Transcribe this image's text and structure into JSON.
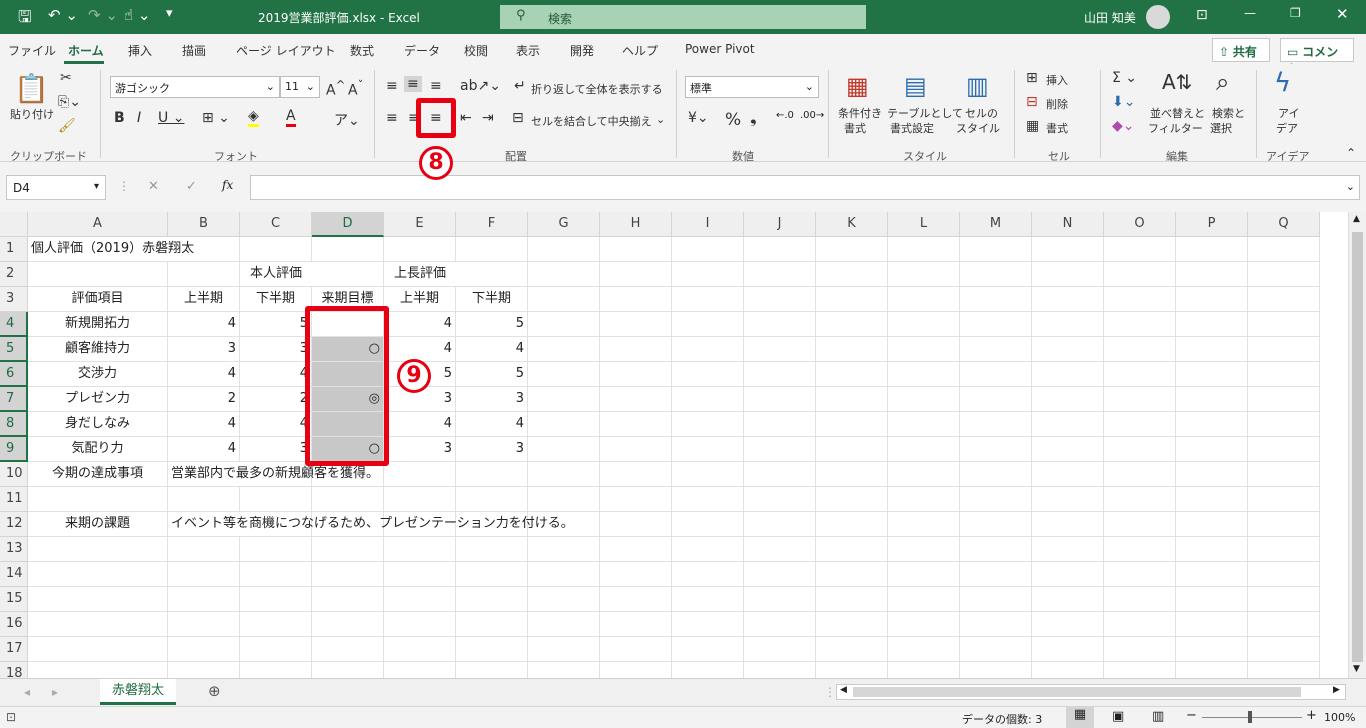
{
  "titlebar": {
    "filename": "2019営業部評価.xlsx - Excel",
    "search_placeholder": "検索",
    "user": "山田 知美"
  },
  "tabs": [
    "ファイル",
    "ホーム",
    "挿入",
    "描画",
    "ページ レイアウト",
    "数式",
    "データ",
    "校閲",
    "表示",
    "開発",
    "ヘルプ",
    "Power Pivot"
  ],
  "share_label": "共有",
  "comment_label": "コメント",
  "ribbon": {
    "paste_label": "貼り付け",
    "clipboard_group": "クリップボード",
    "font_name": "游ゴシック",
    "font_size": "11",
    "font_group": "フォント",
    "wrap_text": "折り返して全体を表示する",
    "merge_center": "セルを結合して中央揃え",
    "alignment_group": "配置",
    "number_format": "標準",
    "number_group": "数値",
    "cond_format": "条件付き\n書式",
    "cond_format_l1": "条件付き",
    "cond_format_l2": "書式",
    "table_format_l1": "テーブルとして",
    "table_format_l2": "書式設定",
    "cell_style_l1": "セルの",
    "cell_style_l2": "スタイル",
    "style_group": "スタイル",
    "insert": "挿入",
    "delete": "削除",
    "format": "書式",
    "cells_group": "セル",
    "sort_l1": "並べ替えと",
    "sort_l2": "フィルター",
    "find_l1": "検索と",
    "find_l2": "選択",
    "edit_group": "編集",
    "ideas_l1": "アイ",
    "ideas_l2": "デア",
    "ideas_group": "アイデア"
  },
  "namebox": "D4",
  "fx": "fx",
  "columns": [
    "A",
    "B",
    "C",
    "D",
    "E",
    "F",
    "G",
    "H",
    "I",
    "J",
    "K",
    "L",
    "M",
    "N",
    "O",
    "P",
    "Q"
  ],
  "rows": [
    "1",
    "2",
    "3",
    "4",
    "5",
    "6",
    "7",
    "8",
    "9",
    "10",
    "11",
    "12",
    "13",
    "14",
    "15",
    "16",
    "17",
    "18"
  ],
  "cells": {
    "A1": "個人評価（2019）赤磐翔太",
    "C2": "本人評価",
    "E2": "上長評価",
    "A3": "評価項目",
    "B3": "上半期",
    "C3": "下半期",
    "D3": "来期目標",
    "E3": "上半期",
    "F3": "下半期",
    "A4": "新規開拓力",
    "B4": "4",
    "C4": "5",
    "E4": "4",
    "F4": "5",
    "A5": "顧客維持力",
    "B5": "3",
    "C5": "3",
    "D5": "○",
    "E5": "4",
    "F5": "4",
    "A6": "交渉力",
    "B6": "4",
    "C6": "4",
    "E6": "5",
    "F6": "5",
    "A7": "プレゼン力",
    "B7": "2",
    "C7": "2",
    "D7": "◎",
    "E7": "3",
    "F7": "3",
    "A8": "身だしなみ",
    "B8": "4",
    "C8": "4",
    "E8": "4",
    "F8": "4",
    "A9": "気配り力",
    "B9": "4",
    "C9": "3",
    "D9": "○",
    "E9": "3",
    "F9": "3",
    "A10": "今期の達成事項",
    "B10": "営業部内で最多の新規顧客を獲得。",
    "A12": "来期の課題",
    "B12": "イベント等を商機につなげるため、プレゼンテーション力を付ける。"
  },
  "sheet_tab": "赤磐翔太",
  "status": {
    "count": "データの個数: 3",
    "zoom": "100%"
  },
  "annotations": {
    "step8": "8",
    "step9": "9"
  },
  "colors": {
    "accent": "#217346",
    "highlight": "#e60012"
  }
}
